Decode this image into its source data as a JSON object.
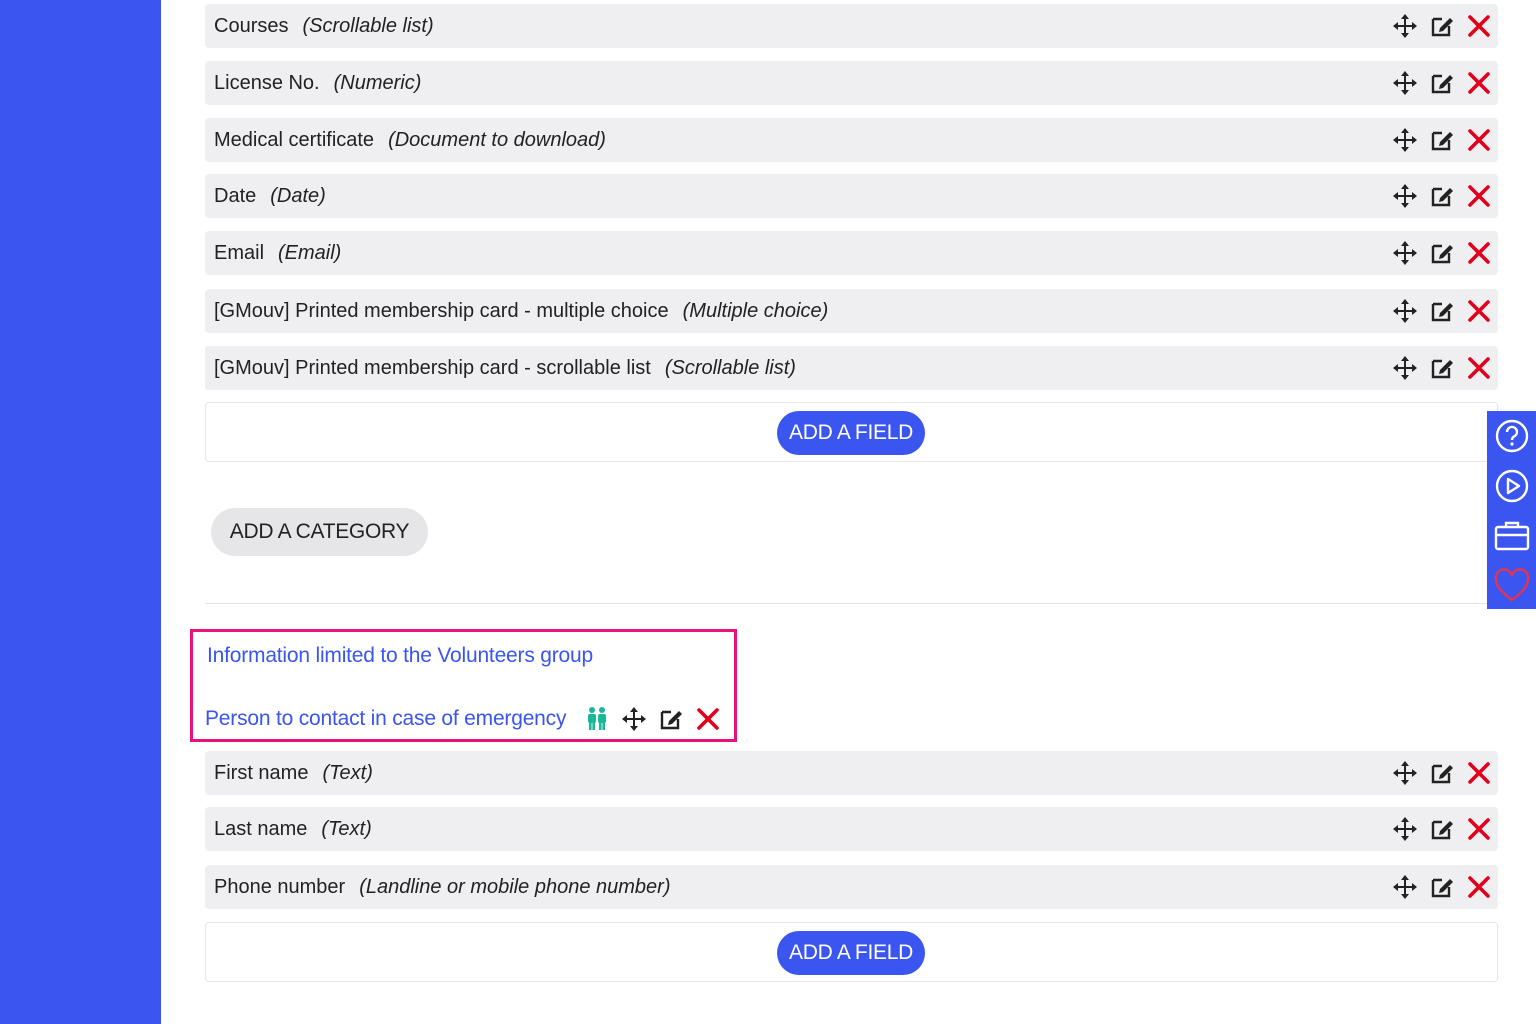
{
  "fields_section_1": [
    {
      "name": "Courses",
      "type": "(Scrollable list)"
    },
    {
      "name": "License No.",
      "type": "(Numeric)"
    },
    {
      "name": "Medical certificate",
      "type": "(Document to download)"
    },
    {
      "name": "Date",
      "type": "(Date)"
    },
    {
      "name": "Email",
      "type": "(Email)"
    },
    {
      "name": "[GMouv] Printed membership card - multiple choice",
      "type": "(Multiple choice)"
    },
    {
      "name": "[GMouv] Printed membership card - scrollable list",
      "type": "(Scrollable list)"
    }
  ],
  "add_field_label": "ADD A FIELD",
  "add_category_label": "ADD A CATEGORY",
  "group_notice": "Information limited to the Volunteers group",
  "category": {
    "name": "Person to contact in case of emergency"
  },
  "fields_section_2": [
    {
      "name": "First name",
      "type": "(Text)"
    },
    {
      "name": "Last name",
      "type": "(Text)"
    },
    {
      "name": "Phone number",
      "type": "(Landline or mobile phone number)"
    }
  ],
  "colors": {
    "brand": "#3a55f0",
    "delete": "#e0001b",
    "group_icon": "#19b89a",
    "highlight": "#e8127a"
  },
  "icons": {
    "move": "move-arrows-icon",
    "edit": "edit-icon",
    "delete": "delete-x-icon",
    "group": "group-people-icon",
    "toolbar": [
      "help-icon",
      "play-icon",
      "briefcase-icon",
      "heart-icon"
    ]
  }
}
